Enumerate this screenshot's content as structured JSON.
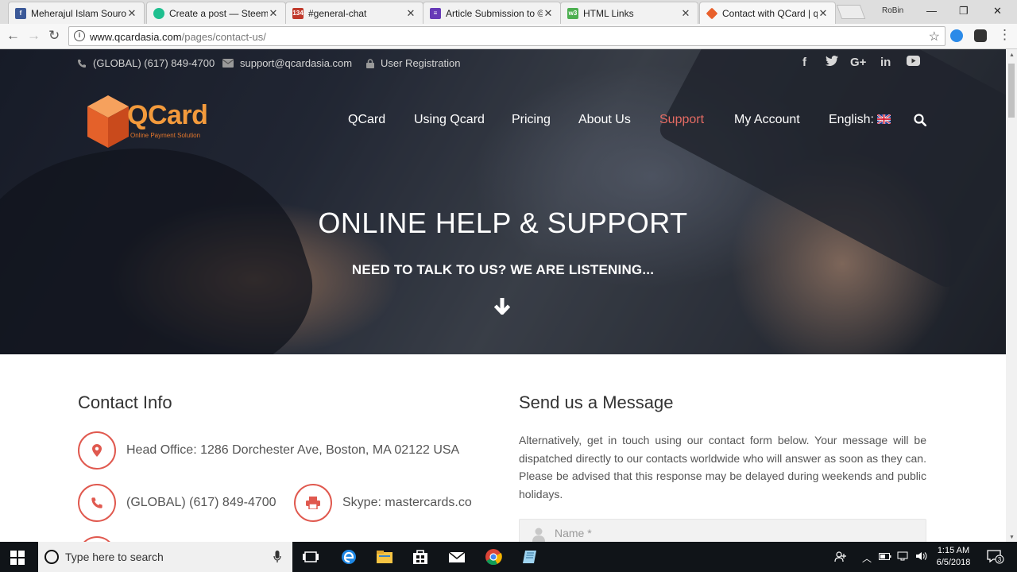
{
  "browser": {
    "tabs": [
      {
        "title": "Meherajul Islam Sourov",
        "favicon": "facebook-icon",
        "color": "#3b5998"
      },
      {
        "title": "Create a post — Steemit",
        "favicon": "steemit-icon",
        "color": "#1fbf8f"
      },
      {
        "title": "#general-chat",
        "favicon": "chat-icon",
        "color": "#c0392b",
        "badge": "134"
      },
      {
        "title": "Article Submission to ©",
        "favicon": "form-icon",
        "color": "#673ab7"
      },
      {
        "title": "HTML Links",
        "favicon": "w3schools-icon",
        "color": "#4caf50"
      },
      {
        "title": "Contact with QCard | qc",
        "favicon": "qcard-icon",
        "color": "#e8602c",
        "active": true
      }
    ],
    "profile_name": "RoBin",
    "url_domain": "www.qcardasia.com",
    "url_path": "/pages/contact-us/"
  },
  "topbar": {
    "phone": "(GLOBAL) (617) 849-4700",
    "email": "support@qcardasia.com",
    "registration": "User Registration",
    "social": [
      "f",
      "🐦",
      "G+",
      "in",
      "▶"
    ]
  },
  "logo": {
    "brand": "QCard",
    "tagline": "Online Payment Solution"
  },
  "nav": {
    "items": [
      "QCard",
      "Using Qcard",
      "Pricing",
      "About Us",
      "Support",
      "My Account",
      "English:"
    ],
    "active": "Support"
  },
  "hero": {
    "title": "ONLINE HELP & SUPPORT",
    "subtitle": "NEED TO TALK TO US? WE ARE LISTENING..."
  },
  "contact": {
    "title": "Contact Info",
    "office": "Head Office: 1286 Dorchester Ave, Boston, MA 02122 USA",
    "phone": "(GLOBAL) (617) 849-4700",
    "skype": "Skype: mastercards.co"
  },
  "message": {
    "title": "Send us a Message",
    "body": "Alternatively, get in touch using our contact form below. Your message will be dispatched directly to our contacts worldwide who will answer as soon as they can. Please be advised that this response may be delayed during weekends and public holidays.",
    "name_placeholder": "Name *"
  },
  "taskbar": {
    "search_placeholder": "Type here to search",
    "time": "1:15 AM",
    "date": "6/5/2018",
    "notifications": "3"
  },
  "colors": {
    "accent": "#e0594f",
    "brand_orange": "#f39a3c"
  }
}
